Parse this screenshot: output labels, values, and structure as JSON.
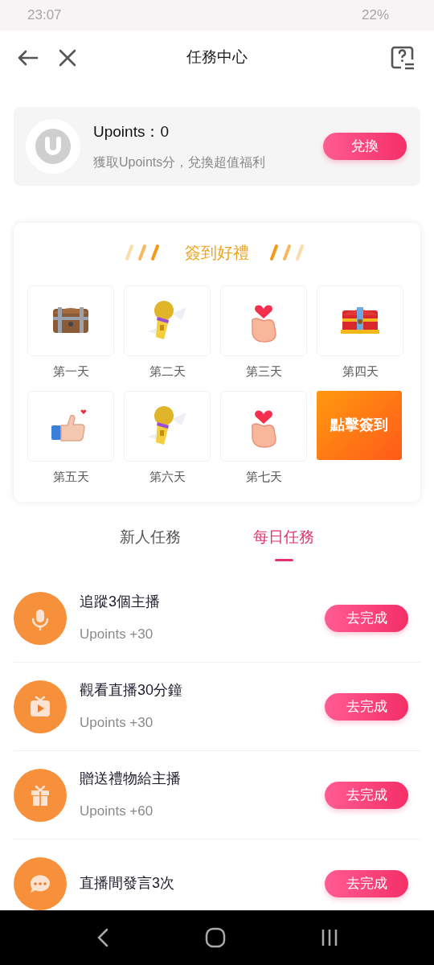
{
  "status_bar": {
    "time": "23:07",
    "battery": "22%"
  },
  "header": {
    "title": "任務中心"
  },
  "points": {
    "title": "Upoints：0",
    "subtitle": "獲取Upoints分，兌換超值福利",
    "button": "兌換"
  },
  "checkin": {
    "title": "簽到好禮",
    "button": "點擊簽到",
    "days": [
      {
        "label": "第一天",
        "kind": "chest"
      },
      {
        "label": "第二天",
        "kind": "mic"
      },
      {
        "label": "第三天",
        "kind": "heart"
      },
      {
        "label": "第四天",
        "kind": "redchest"
      },
      {
        "label": "第五天",
        "kind": "thumb"
      },
      {
        "label": "第六天",
        "kind": "mic"
      },
      {
        "label": "第七天",
        "kind": "heart"
      }
    ]
  },
  "tabs": [
    {
      "label": "新人任務",
      "selected": false
    },
    {
      "label": "每日任務",
      "selected": true
    }
  ],
  "tasks": [
    {
      "kind": "mic",
      "title": "追蹤3個主播",
      "reward": "Upoints +30",
      "button": "去完成"
    },
    {
      "kind": "tv",
      "title": "觀看直播30分鐘",
      "reward": "Upoints +30",
      "button": "去完成"
    },
    {
      "kind": "gift",
      "title": "贈送禮物給主播",
      "reward": "Upoints +60",
      "button": "去完成"
    },
    {
      "kind": "chat",
      "title": "直播間發言3次",
      "button": "去完成"
    }
  ]
}
